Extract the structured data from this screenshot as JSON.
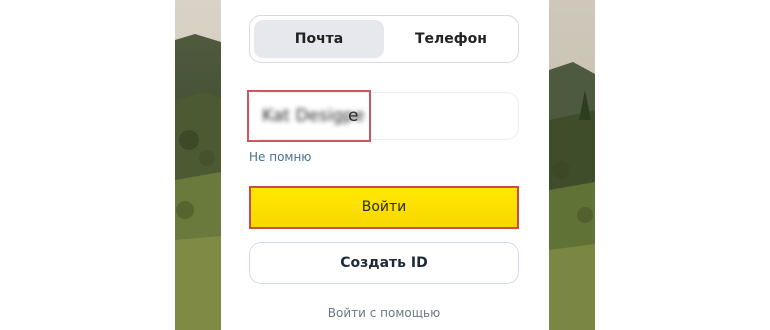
{
  "tabs": [
    {
      "label": "Почта",
      "selected": true
    },
    {
      "label": "Телефон",
      "selected": false
    }
  ],
  "login": {
    "value_obscured": "Kat Desigpe",
    "value_visible": "e"
  },
  "forgot_link": "Не помню",
  "login_button": "Войти",
  "create_button": "Создать ID",
  "alt_login": "Войти с помощью",
  "colors": {
    "accent_yellow": "#ffe000",
    "highlight_red": "#c95760",
    "link": "#4a6f8c"
  }
}
